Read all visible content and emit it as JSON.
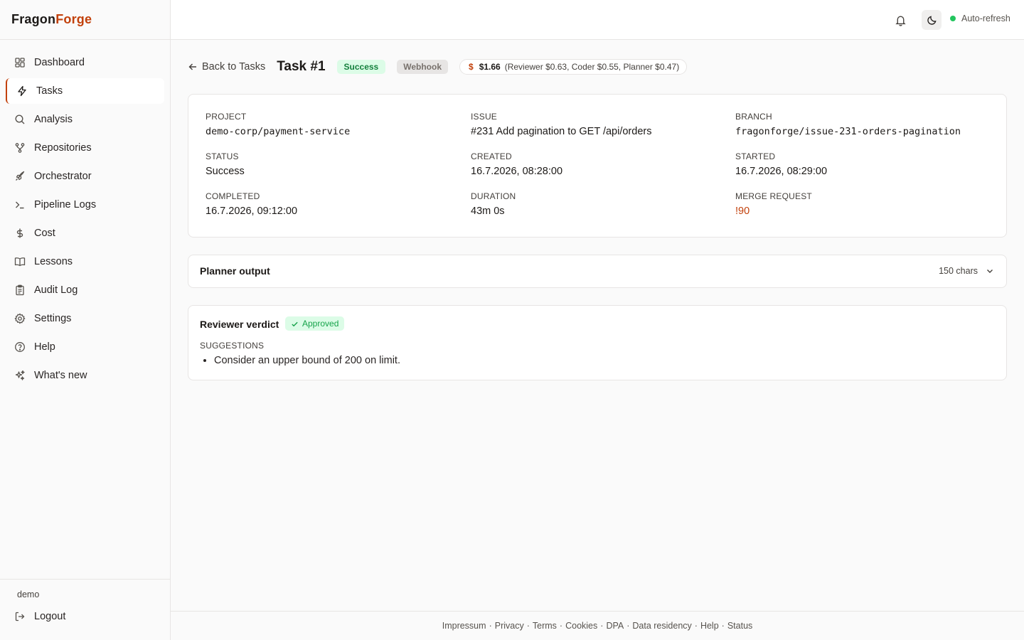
{
  "brand": {
    "part1": "Fragon",
    "part2": "Forge"
  },
  "sidebar": {
    "items": [
      {
        "label": "Dashboard",
        "icon": "dashboard-icon"
      },
      {
        "label": "Tasks",
        "icon": "lightning-icon",
        "active": true
      },
      {
        "label": "Analysis",
        "icon": "search-icon"
      },
      {
        "label": "Repositories",
        "icon": "git-branch-icon"
      },
      {
        "label": "Orchestrator",
        "icon": "rocket-icon"
      },
      {
        "label": "Pipeline Logs",
        "icon": "terminal-icon"
      },
      {
        "label": "Cost",
        "icon": "dollar-icon"
      },
      {
        "label": "Lessons",
        "icon": "book-icon"
      },
      {
        "label": "Audit Log",
        "icon": "clipboard-icon"
      },
      {
        "label": "Settings",
        "icon": "gear-icon"
      },
      {
        "label": "Help",
        "icon": "help-icon"
      },
      {
        "label": "What's new",
        "icon": "sparkles-icon"
      }
    ],
    "user": "demo",
    "logout": "Logout"
  },
  "header": {
    "auto_refresh": "Auto-refresh",
    "accent": "#c2410c",
    "status_color": "#22c55e"
  },
  "task": {
    "back": "Back to Tasks",
    "title": "Task #1",
    "status_badge": "Success",
    "source_badge": "Webhook",
    "cost_symbol": "$",
    "cost_total": "$1.66",
    "cost_breakdown": "(Reviewer $0.63, Coder $0.55, Planner $0.47)"
  },
  "details": {
    "project_label": "PROJECT",
    "project": "demo-corp/payment-service",
    "issue_label": "ISSUE",
    "issue": "#231 Add pagination to GET /api/orders",
    "branch_label": "BRANCH",
    "branch": "fragonforge/issue-231-orders-pagination",
    "status_label": "STATUS",
    "status": "Success",
    "created_label": "CREATED",
    "created": "16.7.2026, 08:28:00",
    "started_label": "STARTED",
    "started": "16.7.2026, 08:29:00",
    "completed_label": "COMPLETED",
    "completed": "16.7.2026, 09:12:00",
    "duration_label": "DURATION",
    "duration": "43m 0s",
    "mr_label": "MERGE REQUEST",
    "mr": "!90"
  },
  "planner": {
    "title": "Planner output",
    "chars": "150 chars"
  },
  "reviewer": {
    "title": "Reviewer verdict",
    "verdict": "Approved",
    "suggestions_label": "SUGGESTIONS",
    "suggestions": [
      "Consider an upper bound of 200 on limit."
    ]
  },
  "footer": {
    "links": [
      "Impressum",
      "Privacy",
      "Terms",
      "Cookies",
      "DPA",
      "Data residency",
      "Help",
      "Status"
    ],
    "separator": "·"
  }
}
